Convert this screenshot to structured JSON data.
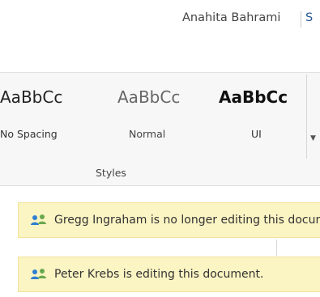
{
  "user": {
    "name": "Anahita Bahrami",
    "next_label": "S"
  },
  "styles_gallery": {
    "group_label": "Styles",
    "items": [
      {
        "preview": "AaBbCc",
        "name": "No Spacing"
      },
      {
        "preview": "AaBbCc",
        "name": "Normal"
      },
      {
        "preview": "AaBbCc",
        "name": "UI"
      }
    ],
    "more_icon": "dropdown-arrow-icon"
  },
  "notifications": [
    {
      "icon": "people-icon",
      "text": "Gregg Ingraham is no longer editing this document."
    },
    {
      "icon": "people-icon",
      "text": "Peter Krebs is editing this document."
    }
  ],
  "colors": {
    "notification_bg": "#fbf4c3",
    "notification_border": "#f0e39a",
    "icon_blue": "#2f7fd1",
    "icon_green": "#6aa84f"
  }
}
